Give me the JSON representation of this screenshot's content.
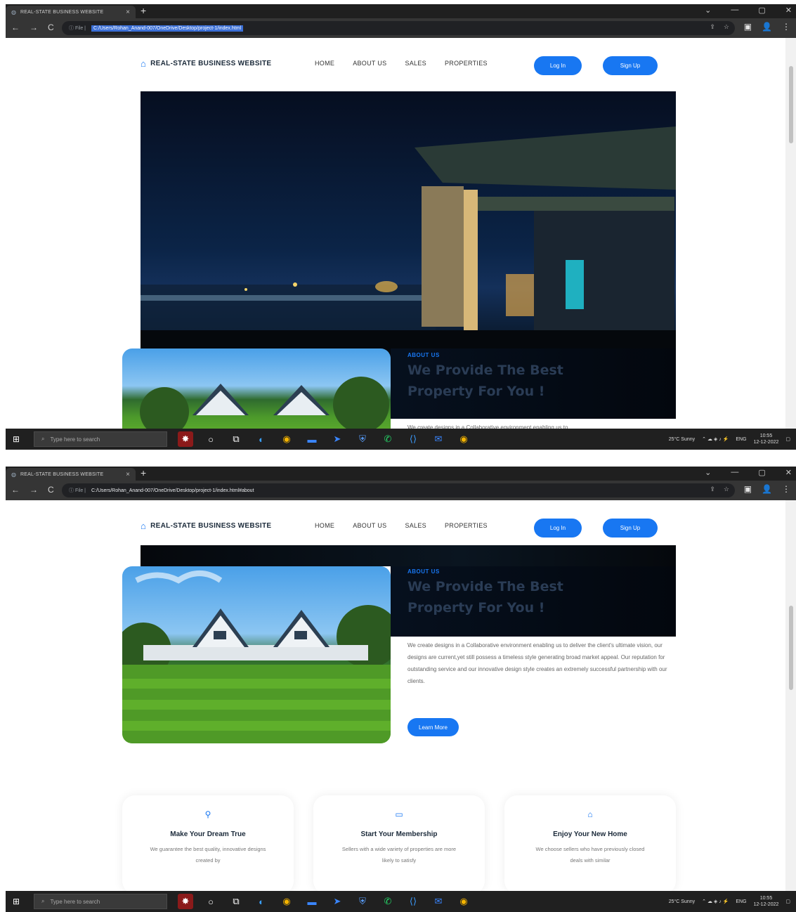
{
  "browser": {
    "tab_title": "REAL-STATE BUSINESS WEBSITE",
    "new_tab": "+",
    "window_controls": [
      "⌄",
      "—",
      "▢",
      "✕"
    ],
    "nav_icons": [
      "←",
      "→",
      "C"
    ],
    "url_info": "ⓘ File |",
    "url_shot1": "C:/Users/Rohan_Anand-007/OneDrive/Desktop/project-1/index.html",
    "url_shot2": "C:/Users/Rohan_Anand-007/OneDrive/Desktop/project-1/index.html#about",
    "omni_icons": [
      "⇪",
      "☆"
    ],
    "right_icons": [
      "▣",
      "👤",
      "⋮"
    ]
  },
  "site": {
    "logo_text": "REAL-STATE BUSINESS WEBSITE",
    "logo_icon": "home-icon",
    "menu": [
      "HOME",
      "ABOUT US",
      "SALES",
      "PROPERTIES"
    ],
    "login": "Log In",
    "signup": "Sign Up"
  },
  "about": {
    "eyebrow": "ABOUT US",
    "title_line1": "We Provide The Best",
    "title_line2": "Property For You !",
    "text": "We create designs in a Collaborative environment enabling us to deliver the client's ultimate vision, our designs are current,yet still possess a timeless style generating broad market appeal. Our reputation for outstanding service and our innovative design style creates an extremely successful partnership with our clients.",
    "text_partial": "We create designs in a Collaborative environment enabling us to",
    "button": "Learn More"
  },
  "cards": [
    {
      "icon": "user-icon",
      "glyph": "⚲",
      "title": "Make Your Dream True",
      "text": "We guarantee the best quality, innovative designs created by"
    },
    {
      "icon": "monitor-icon",
      "glyph": "▭",
      "title": "Start Your Membership",
      "text": "Sellers with a wide variety of properties are more likely to satisfy"
    },
    {
      "icon": "house-icon",
      "glyph": "⌂",
      "title": "Enjoy Your New Home",
      "text": "We choose sellers who have previously closed deals with similar"
    }
  ],
  "taskbar": {
    "search_placeholder": "Type here to search",
    "weather": "25°C Sunny",
    "lang": "ENG",
    "time": "10:55",
    "date": "12-12-2022"
  }
}
